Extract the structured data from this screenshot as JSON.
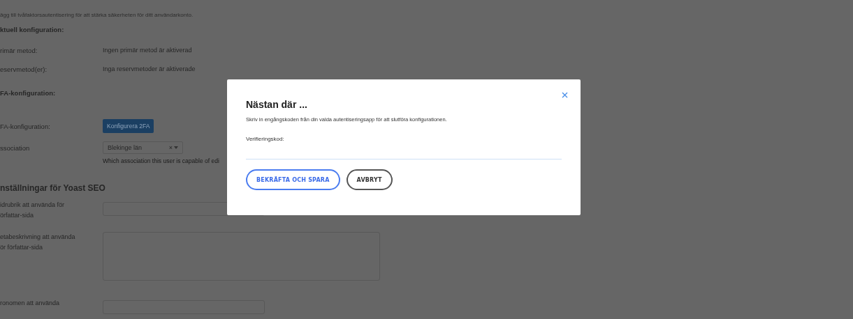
{
  "page": {
    "intro": "ägg till tvåfaktorsautentisering för att stärka säkerheten för ditt användarkonto.",
    "current_config_heading": "ktuell konfiguration:",
    "rows": [
      {
        "kind": "text",
        "label": "rimär metod:",
        "value": "Ingen primär metod är aktiverad"
      },
      {
        "kind": "text",
        "label": "eservmetod(er):",
        "value": "Inga reservmetoder är aktiverade"
      },
      {
        "kind": "heading",
        "label": "FA-konfiguration:"
      },
      {
        "kind": "button",
        "label": "FA-konfiguration:",
        "value": "Konfigurera 2FA"
      },
      {
        "kind": "select",
        "label": "ssociation",
        "value": "Blekinge län",
        "clear": "×",
        "hint": "Which association this user is capable of edi"
      }
    ],
    "yoast_heading": "nställningar för Yoast SEO",
    "yoast_rows": [
      {
        "kind": "input",
        "label": "idrubrik att använda för\nörfattar-sida"
      },
      {
        "kind": "textarea",
        "label": "etabeskrivning att använda\nör författar-sida"
      },
      {
        "kind": "input",
        "label": "ronomen att använda"
      }
    ]
  },
  "modal": {
    "title": "Nästan där ...",
    "text": "Skriv in engångskoden från din valda autentiseringsapp för att slutföra konfigurationen.",
    "field_label": "Verifieringskod:",
    "buttons": [
      {
        "label": "BEKRÄFTA OCH SPARA",
        "kind": "primary"
      },
      {
        "label": "AVBRYT",
        "kind": "secondary"
      }
    ]
  }
}
